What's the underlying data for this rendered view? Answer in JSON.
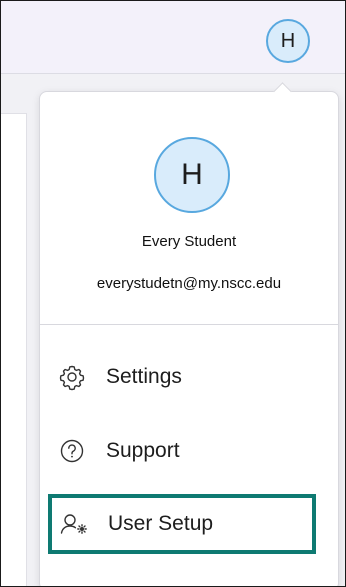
{
  "header": {
    "avatar_initial": "H"
  },
  "profile": {
    "avatar_initial": "H",
    "name": "Every Student",
    "email": "everystudetn@my.nscc.edu"
  },
  "menu": {
    "items": [
      {
        "label": "Settings",
        "icon": "gear-icon"
      },
      {
        "label": "Support",
        "icon": "question-circle-icon"
      },
      {
        "label": "User Setup",
        "icon": "user-gear-icon",
        "highlighted": true
      }
    ]
  },
  "colors": {
    "avatar_fill": "#d9ecfb",
    "avatar_border": "#58a8df",
    "highlight_border": "#0e7a72"
  }
}
